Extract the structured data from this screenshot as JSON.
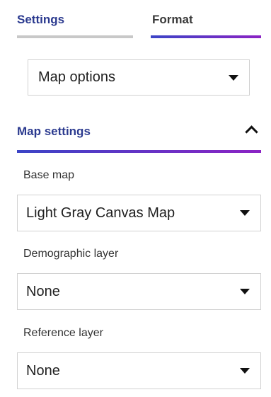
{
  "tabs": {
    "settings_label": "Settings",
    "format_label": "Format"
  },
  "map_options": {
    "selected": "Map options"
  },
  "map_settings": {
    "title": "Map settings",
    "base_map": {
      "label": "Base map",
      "selected": "Light Gray Canvas Map"
    },
    "demographic_layer": {
      "label": "Demographic layer",
      "selected": "None"
    },
    "reference_layer": {
      "label": "Reference layer",
      "selected": "None"
    }
  },
  "colors": {
    "accent_start": "#3b44c6",
    "accent_end": "#8b23c4",
    "title_blue": "#2b3a8f"
  },
  "icons": {
    "dropdown": "caret-down-icon",
    "collapse": "chevron-up-icon"
  }
}
